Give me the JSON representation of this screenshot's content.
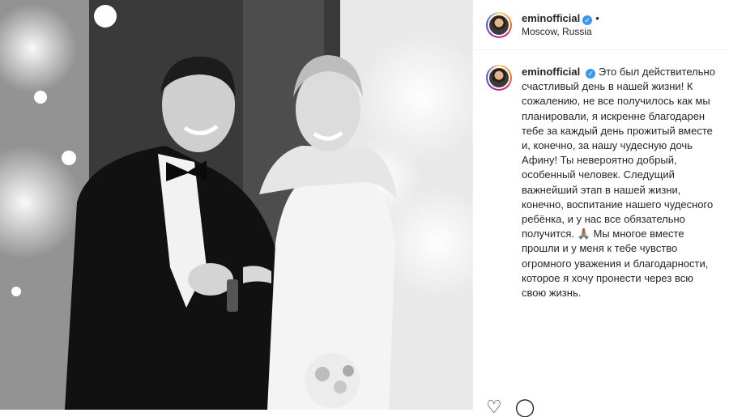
{
  "post": {
    "username": "eminofficial",
    "location": "Moscow, Russia",
    "more_dot": "•",
    "verified_glyph": "✓",
    "caption": "Это был действительно счастливый день в нашей жизни! К сожалению, не все получилось как мы планировали, я искренне благодарен тебе за каждый день прожитый вместе и, конечно, за нашу чудесную дочь Афину! Ты невероятно добрый, особенный человек. Следущий важнейший этап в нашей жизни, конечно, воспитание нашего чудесного ребёнка, и у нас все обязательно получится. 🙏🏽 Мы многое вместе прошли и у меня к тебе чувство огромного уважения и благодарности, которое я хочу пронести через всю свою жизнь."
  },
  "icons": {
    "like": "heart-icon",
    "comment": "comment-icon",
    "like_glyph": "♡",
    "comment_glyph": "◯"
  }
}
